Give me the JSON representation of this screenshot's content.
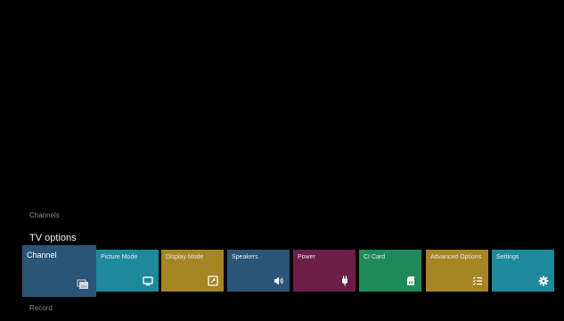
{
  "sections": {
    "channels_label": "Channels",
    "tv_options_title": "TV options",
    "record_label": "Record"
  },
  "tiles": [
    {
      "label": "Channel",
      "icon": "channel-list-icon",
      "color": "#2a5578",
      "focused": true
    },
    {
      "label": "Picture Mode",
      "icon": "tv-screen-icon",
      "color": "#1d8a9c"
    },
    {
      "label": "Display Mode",
      "icon": "aspect-ratio-icon",
      "color": "#a78424"
    },
    {
      "label": "Speakers",
      "icon": "speaker-icon",
      "color": "#2a5578"
    },
    {
      "label": "Power",
      "icon": "power-plug-icon",
      "color": "#6b1f48"
    },
    {
      "label": "CI Card",
      "icon": "sd-card-icon",
      "color": "#1e8a58"
    },
    {
      "label": "Advanced Options",
      "icon": "checklist-icon",
      "color": "#a78424"
    },
    {
      "label": "Settings",
      "icon": "gear-icon",
      "color": "#1d8a9c"
    }
  ]
}
